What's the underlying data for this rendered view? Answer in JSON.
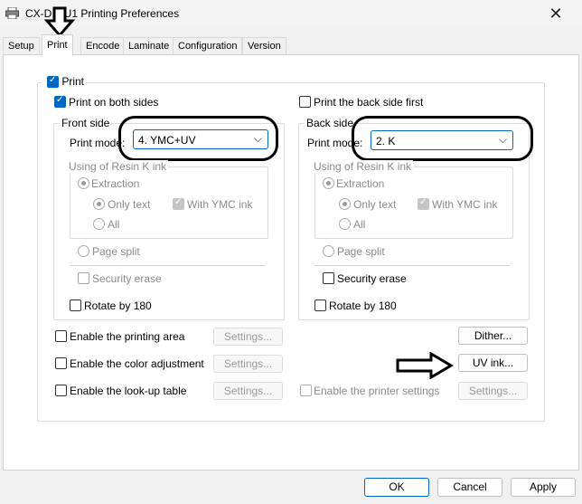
{
  "window": {
    "title": "CX-D... U1 Printing Preferences",
    "close_icon": "close-icon"
  },
  "tabs": [
    {
      "label": "Setup"
    },
    {
      "label": "Print"
    },
    {
      "label": "Encode"
    },
    {
      "label": "Laminate"
    },
    {
      "label": "Configuration"
    },
    {
      "label": "Version"
    }
  ],
  "print": {
    "main_label": "Print",
    "both_sides_label": "Print on both sides",
    "back_first_label": "Print the back side first",
    "front": {
      "title": "Front side",
      "mode_label": "Print mode:",
      "mode_value": "4. YMC+UV",
      "resin_title": "Using of Resin K ink",
      "extraction": "Extraction",
      "only_text": "Only text",
      "with_ymc": "With YMC ink",
      "all": "All",
      "page_split": "Page split",
      "security_erase": "Security erase",
      "rotate": "Rotate by 180"
    },
    "back": {
      "title": "Back side",
      "mode_label": "Print mode:",
      "mode_value": "2. K",
      "resin_title": "Using of Resin K ink",
      "extraction": "Extraction",
      "only_text": "Only text",
      "with_ymc": "With YMC ink",
      "all": "All",
      "page_split": "Page split",
      "security_erase": "Security erase",
      "rotate": "Rotate by 180"
    },
    "options": {
      "printing_area": "Enable the printing area",
      "color_adjustment": "Enable the color adjustment",
      "lookup_table": "Enable the look-up table",
      "printer_settings": "Enable the printer settings"
    },
    "buttons": {
      "settings": "Settings...",
      "dither": "Dither...",
      "uv_ink": "UV ink..."
    }
  },
  "footer": {
    "ok": "OK",
    "cancel": "Cancel",
    "apply": "Apply"
  }
}
